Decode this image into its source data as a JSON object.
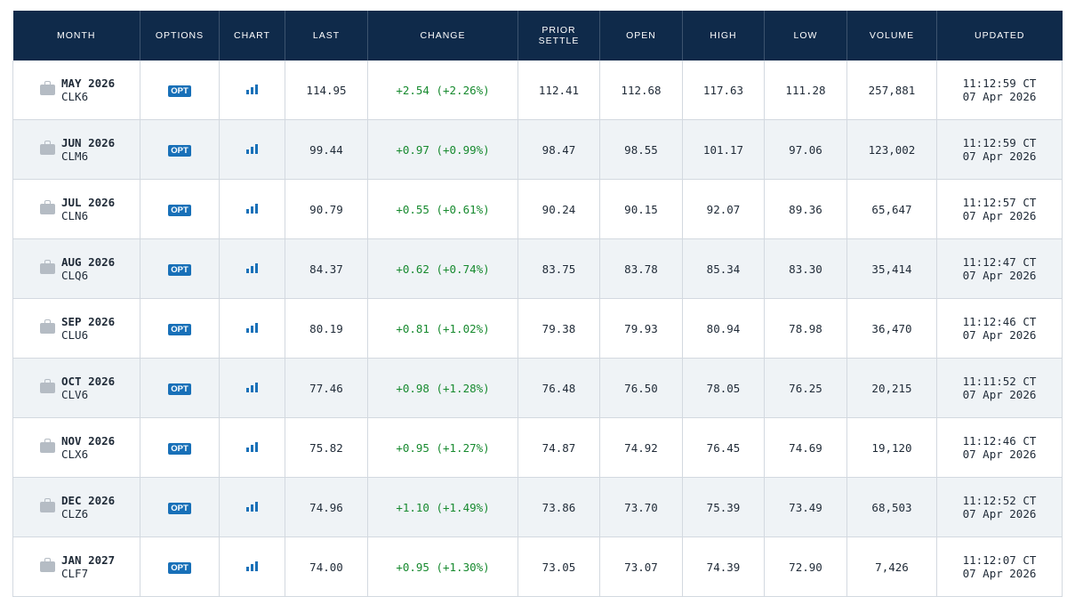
{
  "headers": {
    "month": "MONTH",
    "options": "OPTIONS",
    "chart": "CHART",
    "last": "LAST",
    "change": "CHANGE",
    "prior_settle_1": "PRIOR",
    "prior_settle_2": "SETTLE",
    "open": "OPEN",
    "high": "HIGH",
    "low": "LOW",
    "volume": "VOLUME",
    "updated": "UPDATED"
  },
  "opt_label": "OPT",
  "icons": {
    "month": "briefcase-icon",
    "chart": "bar-chart-icon"
  },
  "colors": {
    "header_bg": "#0f2a4a",
    "opt_badge": "#1870b8",
    "change_positive": "#178a2f",
    "row_alt": "#eff3f6"
  },
  "rows": [
    {
      "month": "MAY 2026",
      "code": "CLK6",
      "last": "114.95",
      "change": "+2.54 (+2.26%)",
      "prior": "112.41",
      "open": "112.68",
      "high": "117.63",
      "low": "111.28",
      "volume": "257,881",
      "time": "11:12:59 CT",
      "date": "07 Apr 2026"
    },
    {
      "month": "JUN 2026",
      "code": "CLM6",
      "last": "99.44",
      "change": "+0.97 (+0.99%)",
      "prior": "98.47",
      "open": "98.55",
      "high": "101.17",
      "low": "97.06",
      "volume": "123,002",
      "time": "11:12:59 CT",
      "date": "07 Apr 2026"
    },
    {
      "month": "JUL 2026",
      "code": "CLN6",
      "last": "90.79",
      "change": "+0.55 (+0.61%)",
      "prior": "90.24",
      "open": "90.15",
      "high": "92.07",
      "low": "89.36",
      "volume": "65,647",
      "time": "11:12:57 CT",
      "date": "07 Apr 2026"
    },
    {
      "month": "AUG 2026",
      "code": "CLQ6",
      "last": "84.37",
      "change": "+0.62 (+0.74%)",
      "prior": "83.75",
      "open": "83.78",
      "high": "85.34",
      "low": "83.30",
      "volume": "35,414",
      "time": "11:12:47 CT",
      "date": "07 Apr 2026"
    },
    {
      "month": "SEP 2026",
      "code": "CLU6",
      "last": "80.19",
      "change": "+0.81 (+1.02%)",
      "prior": "79.38",
      "open": "79.93",
      "high": "80.94",
      "low": "78.98",
      "volume": "36,470",
      "time": "11:12:46 CT",
      "date": "07 Apr 2026"
    },
    {
      "month": "OCT 2026",
      "code": "CLV6",
      "last": "77.46",
      "change": "+0.98 (+1.28%)",
      "prior": "76.48",
      "open": "76.50",
      "high": "78.05",
      "low": "76.25",
      "volume": "20,215",
      "time": "11:11:52 CT",
      "date": "07 Apr 2026"
    },
    {
      "month": "NOV 2026",
      "code": "CLX6",
      "last": "75.82",
      "change": "+0.95 (+1.27%)",
      "prior": "74.87",
      "open": "74.92",
      "high": "76.45",
      "low": "74.69",
      "volume": "19,120",
      "time": "11:12:46 CT",
      "date": "07 Apr 2026"
    },
    {
      "month": "DEC 2026",
      "code": "CLZ6",
      "last": "74.96",
      "change": "+1.10 (+1.49%)",
      "prior": "73.86",
      "open": "73.70",
      "high": "75.39",
      "low": "73.49",
      "volume": "68,503",
      "time": "11:12:52 CT",
      "date": "07 Apr 2026"
    },
    {
      "month": "JAN 2027",
      "code": "CLF7",
      "last": "74.00",
      "change": "+0.95 (+1.30%)",
      "prior": "73.05",
      "open": "73.07",
      "high": "74.39",
      "low": "72.90",
      "volume": "7,426",
      "time": "11:12:07 CT",
      "date": "07 Apr 2026"
    }
  ]
}
